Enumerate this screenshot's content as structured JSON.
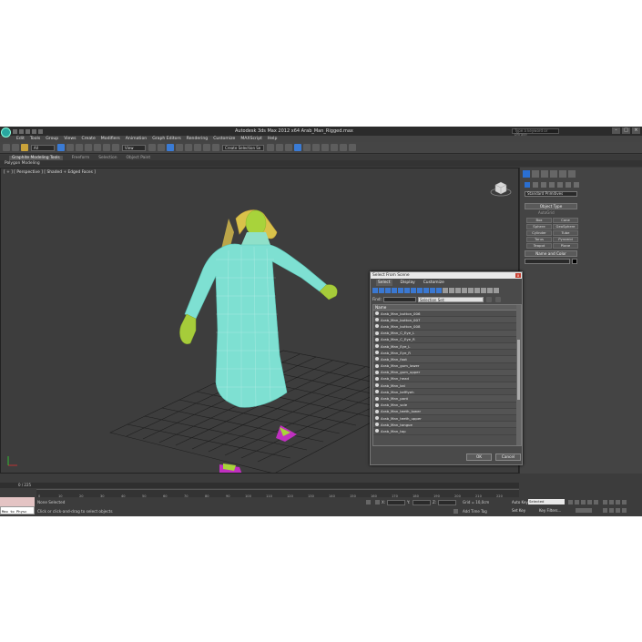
{
  "window": {
    "title": "Autodesk 3ds Max 2012 x64      Arab_Man_Rigged.max",
    "help_search_placeholder": "Type a keyword or phrase"
  },
  "menu": [
    "Edit",
    "Tools",
    "Group",
    "Views",
    "Create",
    "Modifiers",
    "Animation",
    "Graph Editors",
    "Rendering",
    "Customize",
    "MAXScript",
    "Help"
  ],
  "toolbar": {
    "filter_dropdown": "All",
    "view_dropdown": "View",
    "selection_set_dropdown": "Create Selection Se"
  },
  "ribbon": {
    "tabs": [
      "Graphite Modeling Tools",
      "Freeform",
      "Selection",
      "Object Paint"
    ],
    "sub": "Polygon Modeling"
  },
  "viewport": {
    "label": "[ + ] [ Perspective ] [ Shaded + Edged Faces ]"
  },
  "command_panel": {
    "dropdown": "Standard Primitives",
    "object_type_rollout": "Object Type",
    "autogrid": "AutoGrid",
    "primitives": [
      "Box",
      "Cone",
      "Sphere",
      "GeoSphere",
      "Cylinder",
      "Tube",
      "Torus",
      "Pyramid",
      "Teapot",
      "Plane"
    ],
    "name_color_rollout": "Name and Color"
  },
  "dialog": {
    "title": "Select From Scene",
    "close": "x",
    "tabs": [
      "Select",
      "Display",
      "Customize"
    ],
    "find_label": "Find:",
    "selection_set": "Selection Set:",
    "column_header": "Name",
    "items": [
      "Arab_Man_button_006",
      "Arab_Man_button_007",
      "Arab_Man_button_008",
      "Arab_Man_C_Eye_L",
      "Arab_Man_C_Eye_R",
      "Arab_Man_Eye_L",
      "Arab_Man_Eye_R",
      "Arab_Man_foot",
      "Arab_Man_gum_lower",
      "Arab_Man_gum_upper",
      "Arab_Man_head",
      "Arab_Man_kal",
      "Arab_Man_keffiyeh",
      "Arab_Man_pant",
      "Arab_Man_sole",
      "Arab_Man_teeth_lower",
      "Arab_Man_teeth_upper",
      "Arab_Man_tongue",
      "Arab_Man_top"
    ],
    "ok_label": "OK",
    "cancel_label": "Cancel"
  },
  "timeline": {
    "slider_label": "0 / 225",
    "ticks": [
      "0",
      "10",
      "20",
      "30",
      "40",
      "50",
      "60",
      "70",
      "80",
      "90",
      "100",
      "110",
      "120",
      "130",
      "140",
      "150",
      "160",
      "170",
      "180",
      "190",
      "200",
      "210",
      "220"
    ]
  },
  "status": {
    "maxscript": "Max to Physc",
    "selection": "None Selected",
    "prompt": "Click or click-and-drag to select objects",
    "x_label": "X:",
    "y_label": "Y:",
    "z_label": "Z:",
    "grid": "Grid = 10,0cm",
    "add_time_tag": "Add Time Tag",
    "auto_key": "Auto Key",
    "selected": "Selected",
    "set_key": "Set Key",
    "key_filters": "Key Filters..."
  }
}
